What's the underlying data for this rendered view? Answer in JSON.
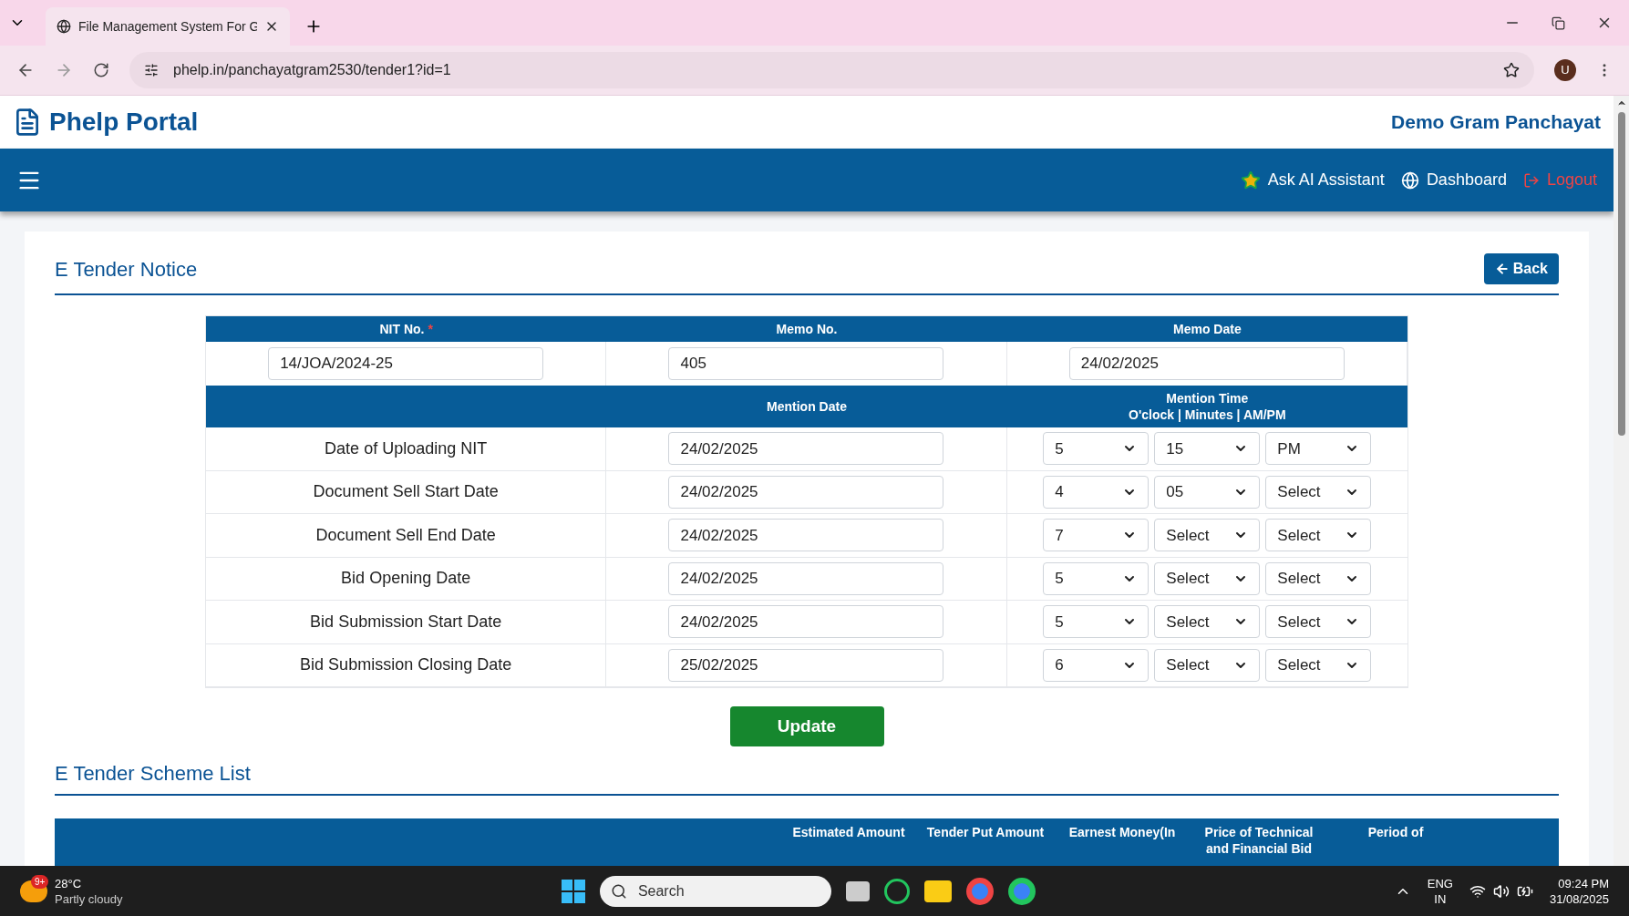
{
  "browser": {
    "tab_title": "File Management System For G",
    "url": "phelp.in/panchayatgram2530/tender1?id=1",
    "profile_initial": "U"
  },
  "header": {
    "brand": "Phelp Portal",
    "org": "Demo Gram Panchayat"
  },
  "nav": [
    {
      "kind": "ai",
      "label": "Ask AI Assistant"
    },
    {
      "kind": "dashboard",
      "label": "Dashboard"
    },
    {
      "kind": "logout",
      "label": "Logout"
    }
  ],
  "notice": {
    "title": "E Tender Notice",
    "back_button": "Back",
    "required_mark": "*",
    "header_fields": [
      {
        "label": "NIT No.",
        "required": true,
        "value": "14/JOA/2024-25"
      },
      {
        "label": "Memo No.",
        "required": false,
        "value": "405"
      },
      {
        "label": "Memo Date",
        "required": false,
        "value": "24/02/2025"
      }
    ],
    "date_heading": "Mention Date",
    "time_heading": "Mention Time",
    "time_subheading": "O'clock | Minutes | AM/PM",
    "rows": [
      {
        "label": "Date of Uploading NIT",
        "date": "24/02/2025",
        "hour": "5",
        "minute": "15",
        "ampm": "PM"
      },
      {
        "label": "Document Sell Start Date",
        "date": "24/02/2025",
        "hour": "4",
        "minute": "05",
        "ampm": "Select"
      },
      {
        "label": "Document Sell End Date",
        "date": "24/02/2025",
        "hour": "7",
        "minute": "Select",
        "ampm": "Select"
      },
      {
        "label": "Bid Opening Date",
        "date": "24/02/2025",
        "hour": "5",
        "minute": "Select",
        "ampm": "Select"
      },
      {
        "label": "Bid Submission Start Date",
        "date": "24/02/2025",
        "hour": "5",
        "minute": "Select",
        "ampm": "Select"
      },
      {
        "label": "Bid Submission Closing Date",
        "date": "25/02/2025",
        "hour": "6",
        "minute": "Select",
        "ampm": "Select"
      }
    ],
    "update_button": "Update"
  },
  "scheme_list": {
    "title": "E Tender Scheme List",
    "columns": [
      "Estimated Amount",
      "Tender Put Amount",
      "Earnest Money(In",
      "Price of Technical and Financial Bid",
      "Period of"
    ]
  },
  "taskbar": {
    "weather_badge": "9+",
    "temperature": "28°C",
    "condition": "Partly cloudy",
    "search_placeholder": "Search",
    "language": "ENG",
    "region": "IN",
    "time": "09:24 PM",
    "date": "31/08/2025"
  }
}
